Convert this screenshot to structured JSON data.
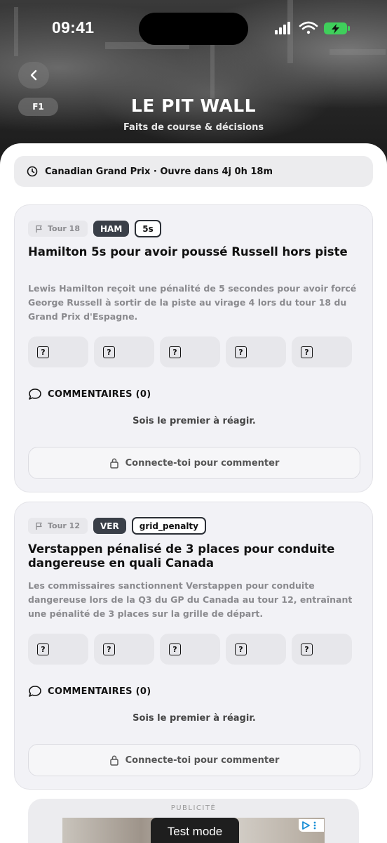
{
  "status_bar": {
    "time": "09:41"
  },
  "header": {
    "badge": "F1",
    "title": "LE PIT WALL",
    "subtitle": "Faits de course & décisions"
  },
  "race_bar": {
    "text": "Canadian Grand Prix · Ouvre dans 4j 0h 18m",
    "icon": "clock-icon"
  },
  "cards": [
    {
      "lap": "Tour 18",
      "driver": "HAM",
      "penalty_type": "5s",
      "title": "Hamilton 5s pour avoir poussé Russell hors piste",
      "description": "Lewis Hamilton reçoit une pénalité de 5 secondes pour avoir forcé George Russell à sortir de la piste au virage 4 lors du tour 18 du Grand Prix d'Espagne.",
      "reactions": [
        "?",
        "?",
        "?",
        "?",
        "?"
      ],
      "comments_label": "COMMENTAIRES (0)",
      "empty_message": "Sois le premier à réagir.",
      "login_label": "Connecte-toi pour commenter"
    },
    {
      "lap": "Tour 12",
      "driver": "VER",
      "penalty_type": "grid_penalty",
      "title": "Verstappen pénalisé de 3 places pour conduite dangereuse en quali Canada",
      "description": "Les commissaires sanctionnent Verstappen pour conduite dangereuse lors de la Q3 du GP du Canada au tour 12, entraînant une pénalité de 3 places sur la grille de départ.",
      "reactions": [
        "?",
        "?",
        "?",
        "?",
        "?"
      ],
      "comments_label": "COMMENTAIRES (0)",
      "empty_message": "Sois le premier à réagir.",
      "login_label": "Connecte-toi pour commenter"
    }
  ],
  "ad": {
    "label": "PUBLICITÉ",
    "mode_text": "Test mode"
  },
  "colors": {
    "driver_chip": "#3a3f48",
    "card_bg": "#f2f2f6",
    "muted_text": "#8a8a8e"
  }
}
